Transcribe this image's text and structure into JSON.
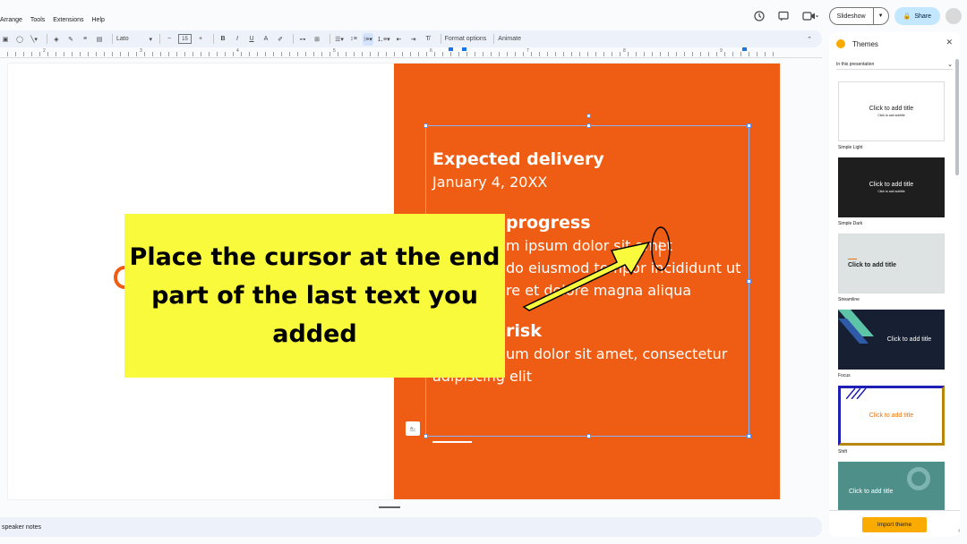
{
  "menu": [
    "Arrange",
    "Tools",
    "Extensions",
    "Help"
  ],
  "header": {
    "slideshow_label": "Slideshow",
    "share_label": "Share"
  },
  "toolbar": {
    "font_name": "Lato",
    "font_size": "15",
    "format_options_label": "Format options",
    "animate_label": "Animate"
  },
  "ruler": {
    "numbers": [
      "2",
      "3",
      "4",
      "5",
      "6",
      "7",
      "8",
      "9"
    ]
  },
  "slide": {
    "heading1": "Expected delivery",
    "body1": "January 4, 20XX",
    "heading2": "progress",
    "body2_line1": "m ipsum dolor sit amet",
    "body2_line2": "do eiusmod tempor incididunt ut",
    "body2_line3": "re et dolore magna aliqua",
    "heading3": "risk",
    "body3_line1": "um dolor sit amet, consectetur",
    "body3_line2": "adipiscing elit",
    "accent_color": "#ef5d14"
  },
  "callout": {
    "text": "Place the cursor at the end part of the last text you added",
    "color": "#fafa3c"
  },
  "speaker_notes_label": "speaker notes",
  "themes_panel": {
    "title": "Themes",
    "source_select": "In this presentation",
    "items": [
      {
        "name": "Simple Light",
        "title": "Click to add title",
        "subtitle": "Click to add subtitle"
      },
      {
        "name": "Simple Dark",
        "title": "Click to add title",
        "subtitle": "Click to add subtitle"
      },
      {
        "name": "Streamline",
        "title": "Click to add title",
        "subtitle": ""
      },
      {
        "name": "Focus",
        "title": "Click to add title",
        "subtitle": ""
      },
      {
        "name": "Shift",
        "title": "Click to add title",
        "subtitle": ""
      },
      {
        "name": "",
        "title": "Click to add title",
        "subtitle": ""
      }
    ],
    "import_label": "Import theme"
  }
}
